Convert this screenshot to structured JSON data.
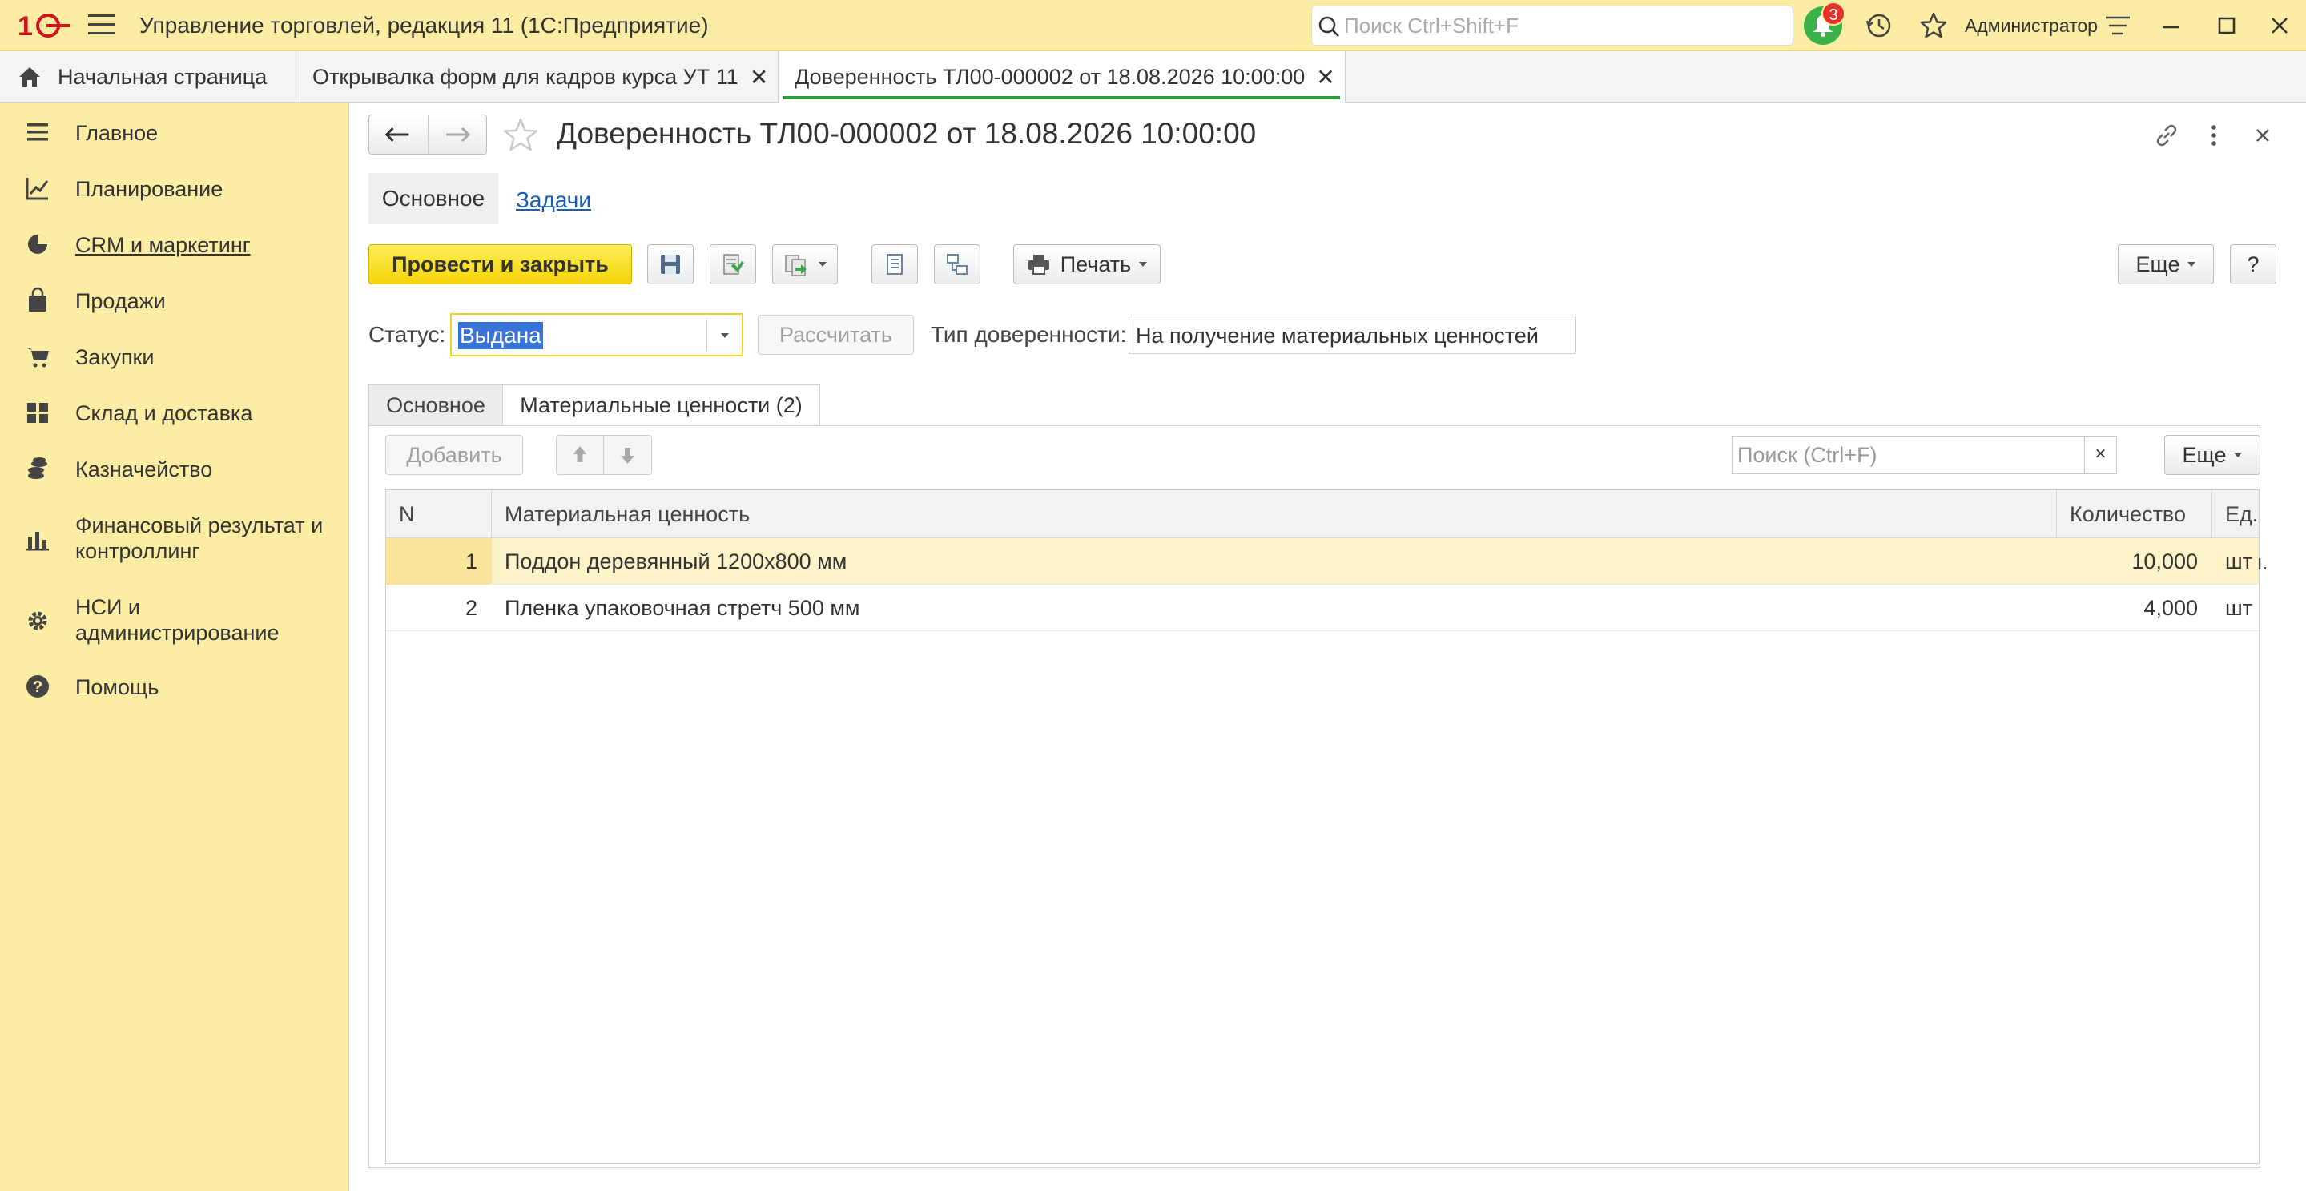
{
  "titlebar": {
    "app_title": "Управление торговлей, редакция 11  (1С:Предприятие)",
    "search_placeholder": "Поиск Ctrl+Shift+F",
    "notifications_count": "3",
    "user": "Администратор"
  },
  "tabs": [
    {
      "label": "Начальная страница"
    },
    {
      "label": "Открывалка форм для кадров курса УТ 11"
    },
    {
      "label": "Доверенность ТЛ00-000002 от 18.08.2026 10:00:00"
    }
  ],
  "sidebar": {
    "items": [
      {
        "label": "Главное",
        "icon": "menu-lines-icon"
      },
      {
        "label": "Планирование",
        "icon": "planning-chart-icon"
      },
      {
        "label": "CRM и маркетинг",
        "icon": "pie-chart-icon"
      },
      {
        "label": "Продажи",
        "icon": "shopping-bag-icon"
      },
      {
        "label": "Закупки",
        "icon": "cart-icon"
      },
      {
        "label": "Склад и доставка",
        "icon": "warehouse-grid-icon"
      },
      {
        "label": "Казначейство",
        "icon": "coins-icon"
      },
      {
        "label": "Финансовый результат и контроллинг",
        "icon": "bar-chart-icon"
      },
      {
        "label": "НСИ и администрирование",
        "icon": "gear-icon"
      },
      {
        "label": "Помощь",
        "icon": "help-icon"
      }
    ]
  },
  "form": {
    "title": "Доверенность ТЛ00-000002 от 18.08.2026 10:00:00",
    "nav_tabs": [
      "Основное",
      "Задачи"
    ],
    "toolbar": {
      "post_and_close": "Провести и закрыть",
      "print": "Печать",
      "more": "Еще",
      "help": "?"
    },
    "status_label": "Статус:",
    "status_value": "Выдана",
    "calculate": "Рассчитать",
    "type_label": "Тип доверенности:",
    "type_value": "На получение материальных ценностей",
    "page_tabs": [
      "Основное",
      "Материальные ценности (2)"
    ]
  },
  "table": {
    "add_button": "Добавить",
    "search_placeholder": "Поиск (Ctrl+F)",
    "clear": "×",
    "more": "Еще",
    "columns": [
      "N",
      "Материальная ценность",
      "Количество",
      "Ед. изм."
    ],
    "rows": [
      {
        "n": "1",
        "item": "Поддон деревянный 1200x800 мм",
        "qty": "10,000",
        "unit": "шт"
      },
      {
        "n": "2",
        "item": "Пленка упаковочная стретч 500 мм",
        "qty": "4,000",
        "unit": "шт"
      }
    ]
  },
  "colors": {
    "accent_yellow": "#fbeda4",
    "primary_button": "#f5d60a",
    "active_tab_underline": "#2d9a3a",
    "notification_green": "#3bb14a",
    "badge_red": "#e8312b"
  }
}
